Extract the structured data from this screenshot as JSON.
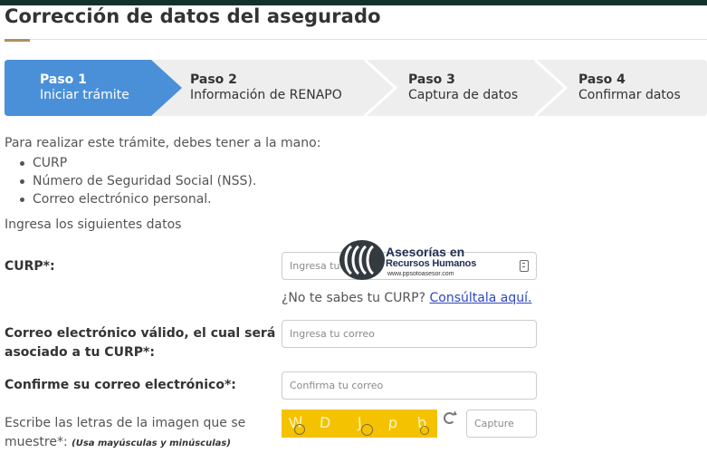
{
  "header": {
    "title": "Corrección de datos del asegurado"
  },
  "stepper": {
    "steps": [
      {
        "number": "Paso 1",
        "label": "Iniciar trámite",
        "active": true
      },
      {
        "number": "Paso 2",
        "label": "Información de RENAPO",
        "active": false
      },
      {
        "number": "Paso 3",
        "label": "Captura de datos",
        "active": false
      },
      {
        "number": "Paso 4",
        "label": "Confirmar datos",
        "active": false
      }
    ]
  },
  "intro": {
    "text": "Para realizar este trámite, debes tener a la mano:",
    "requirements": [
      "CURP",
      "Número de Seguridad Social (NSS).",
      "Correo electrónico personal."
    ],
    "instruction": "Ingresa los siguientes datos"
  },
  "form": {
    "curp": {
      "label": "CURP*:",
      "placeholder": "Ingresa tu CURP",
      "help_text": "¿No te sabes tu CURP? ",
      "help_link": "Consúltala aquí."
    },
    "email": {
      "label_line1": "Correo electrónico válido, el cual será",
      "label_line2": "asociado a tu CURP*:",
      "placeholder": "Ingresa tu correo"
    },
    "email_confirm": {
      "label": "Confirme su correo electrónico*:",
      "placeholder": "Confirma tu correo"
    },
    "captcha": {
      "label_line1": "Escribe las letras de la imagen que se",
      "label_line2": "muestre*: ",
      "note": "(Usa mayúsculas y minúsculas)",
      "letters": [
        "W",
        "D",
        "J",
        "p",
        "b"
      ],
      "placeholder": "Capture"
    }
  },
  "watermark": {
    "line1": "Asesorías en",
    "line2": "Recursos Humanos",
    "line3": "www.ppsotoasesor.com"
  },
  "colors": {
    "active_step": "#4a90d9",
    "inactive_step": "#eeeeee",
    "accent_gold": "#b38e5d",
    "link": "#2e46c4",
    "captcha_bg": "#f4c200"
  },
  "icons": {
    "curp_field": "id-card-icon",
    "captcha_refresh": "refresh-icon"
  }
}
